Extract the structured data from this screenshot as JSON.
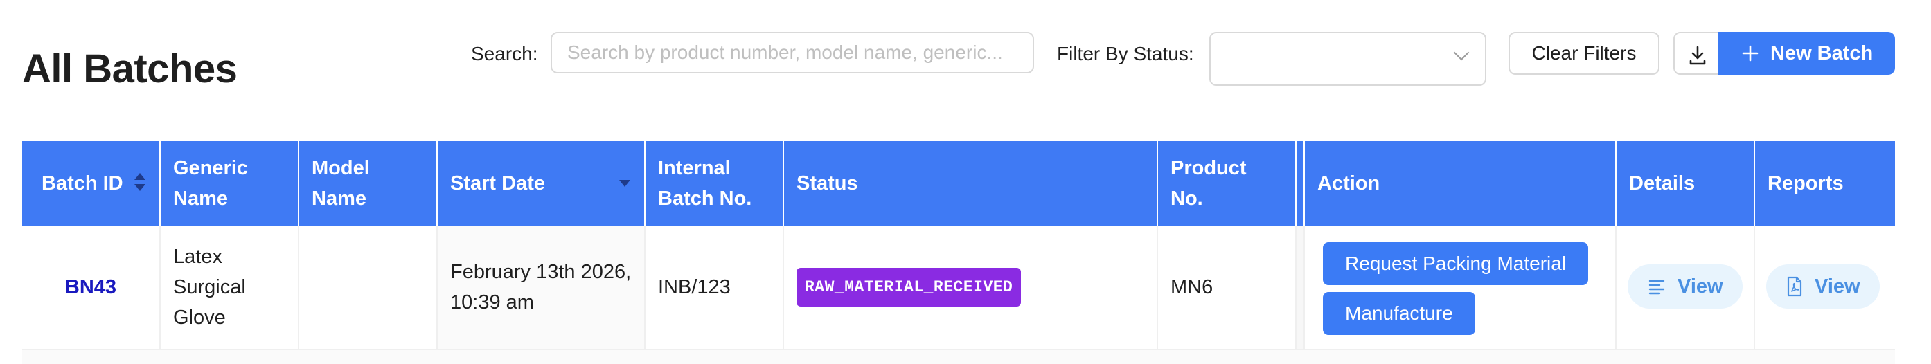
{
  "page": {
    "title": "All Batches"
  },
  "toolbar": {
    "search_label": "Search:",
    "search_placeholder": "Search by product number, model name, generic...",
    "search_value": "",
    "filter_label": "Filter By Status:",
    "filter_value": "",
    "clear_label": "Clear Filters",
    "download_icon": "download-icon",
    "new_batch_label": "New Batch",
    "new_batch_icon": "plus-icon"
  },
  "colors": {
    "header_bg": "#3f7af4",
    "primary": "#3b7bf5",
    "status_badge": "#8a2be2",
    "link": "#1a1abf",
    "view_bg": "#e8f4fd",
    "view_text": "#4a90e2"
  },
  "table": {
    "columns": [
      {
        "label": "Batch ID",
        "sort": "both"
      },
      {
        "label": "Generic Name"
      },
      {
        "label": "Model Name"
      },
      {
        "label": "Start Date",
        "sort": "descending"
      },
      {
        "label": "Internal Batch No."
      },
      {
        "label": "Status"
      },
      {
        "label": "Product No."
      },
      {
        "label": "Action"
      },
      {
        "label": "Details"
      },
      {
        "label": "Reports"
      }
    ],
    "rows": [
      {
        "batch_id": "BN43",
        "generic_name": "Latex Surgical Glove",
        "model_name": "",
        "start_date": "February 13th 2026, 10:39 am",
        "internal_batch_no": "INB/123",
        "status": "RAW_MATERIAL_RECEIVED",
        "product_no": "MN6",
        "actions": [
          "Request Packing Material",
          "Manufacture"
        ],
        "details_label": "View",
        "details_icon": "lines-icon",
        "reports_label": "View",
        "reports_icon": "file-pdf-icon"
      }
    ]
  }
}
